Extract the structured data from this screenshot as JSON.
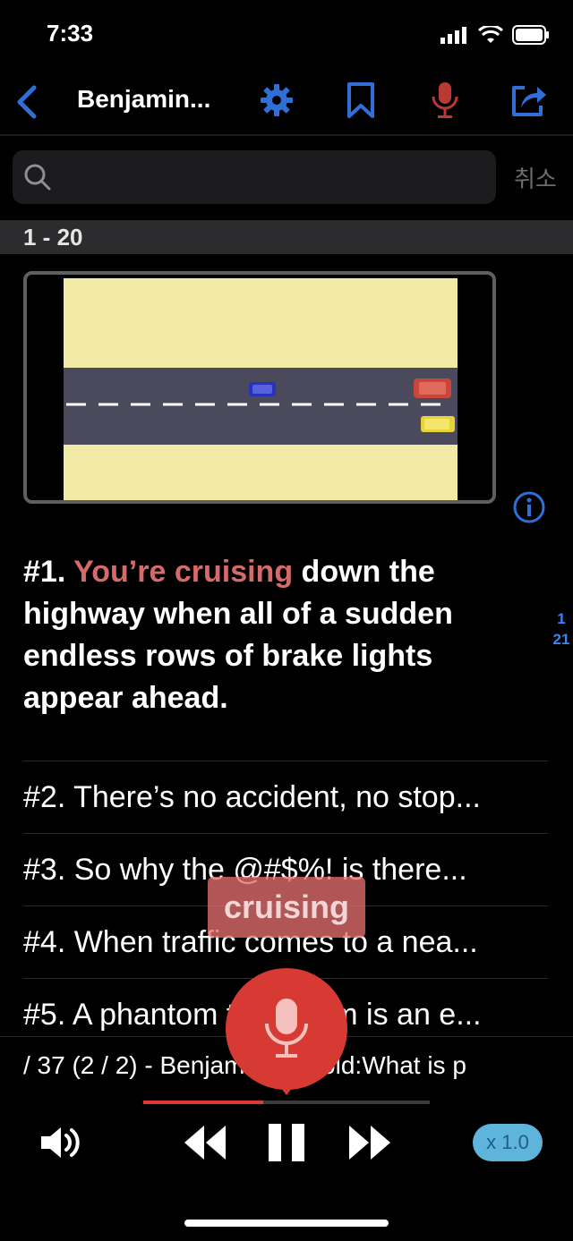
{
  "status": {
    "time": "7:33"
  },
  "nav": {
    "title": "Benjamin...",
    "back_icon": "chevron-left-icon",
    "buttons": [
      "gear-icon",
      "bookmark-icon",
      "mic-icon",
      "share-icon"
    ]
  },
  "search": {
    "placeholder": "",
    "cancel_label": "취소"
  },
  "section": {
    "label": "1 - 20"
  },
  "sentences": {
    "main_number": "#1.",
    "main_highlight": "You’re cruising",
    "main_rest": "down the highway when all of a sudden endless rows of brake lights appear ahead.",
    "side_index_top": "1",
    "side_index_bottom": "21",
    "items": [
      "#2. There’s no accident, no stop...",
      "#3. So why the @#$%! is there...",
      "#4. When traffic comes to a nea...",
      "#5. A phantom traffic jam is an e..."
    ]
  },
  "popup": {
    "word": "cruising"
  },
  "player": {
    "title": "/ 37 (2 / 2) - Benjamin Seibold:What is p",
    "speed": "x 1.0",
    "progress_fraction": 0.42
  },
  "colors": {
    "accent_blue": "#2f6fd6",
    "highlight_red": "#d46a6a",
    "mic_red": "#d63a33",
    "speed_pill": "#5fb4dc"
  }
}
